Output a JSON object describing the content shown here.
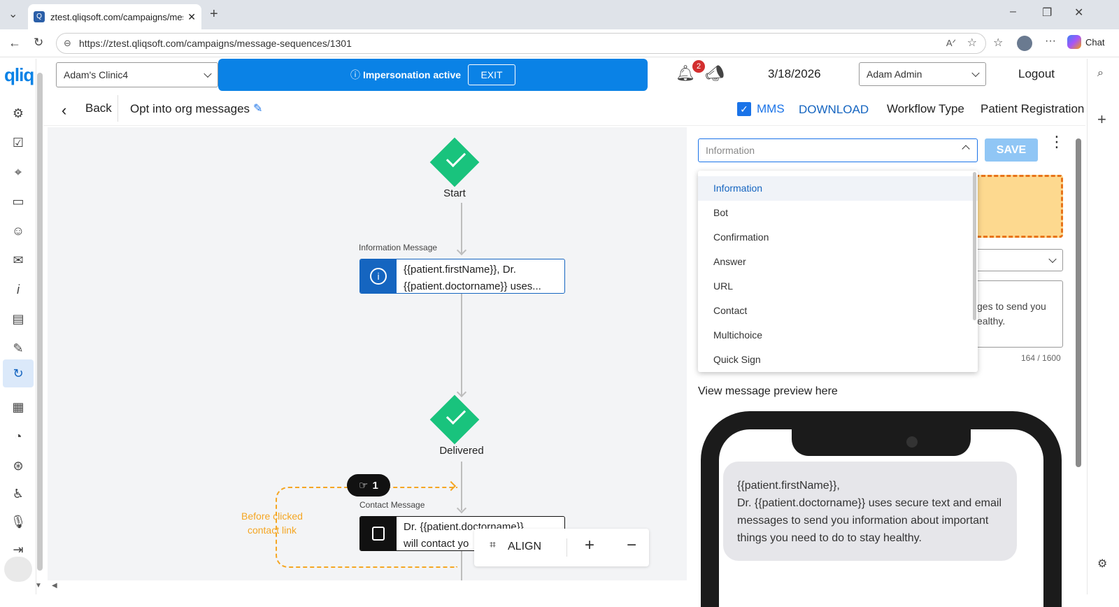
{
  "browser": {
    "tab_title": "ztest.qliqsoft.com/campaigns/mes",
    "url": "https://ztest.qliqsoft.com/campaigns/message-sequences/1301",
    "chat_label": "Chat"
  },
  "app": {
    "logo": "qliq",
    "clinic_select": "Adam's Clinic4",
    "impersonation_text": "Impersonation active",
    "exit_label": "EXIT",
    "notification_count": "2",
    "date": "3/18/2026",
    "user_select": "Adam Admin",
    "logout_label": "Logout"
  },
  "subheader": {
    "back_label": "Back",
    "sequence_title": "Opt into org messages",
    "mms_label": "MMS",
    "mms_checked": true,
    "download_label": "DOWNLOAD",
    "workflow_type_label": "Workflow Type",
    "workflow_type_value": "Patient Registration"
  },
  "canvas": {
    "start_label": "Start",
    "info_node_caption": "Information Message",
    "info_node_line1": "{{patient.firstName}}, Dr.",
    "info_node_line2": "{{patient.doctorname}} uses...",
    "delivered_label": "Delivered",
    "badge_count": "1",
    "branch_label_line1": "Before clicked",
    "branch_label_line2": "contact link",
    "contact_node_caption": "Contact Message",
    "contact_node_line1": "Dr. {{patient.doctorname}}",
    "contact_node_line2": "will contact yo",
    "align_label": "ALIGN"
  },
  "rightpane": {
    "type_select_value": "Information",
    "save_label": "SAVE",
    "dropdown_options": [
      "Information",
      "Bot",
      "Confirmation",
      "Answer",
      "URL",
      "Contact",
      "Multichoice",
      "Quick Sign"
    ],
    "textarea_visible_line1": "ges to send you",
    "textarea_visible_line2": "ealthy.",
    "char_count": "164 / 1600",
    "preview_heading": "View message preview here",
    "preview_line1": "{{patient.firstName}},",
    "preview_line2": "Dr. {{patient.doctorname}} uses secure text and email",
    "preview_line3": "messages to send you information about important",
    "preview_line4": "things you need to do to stay healthy."
  },
  "colors": {
    "accent": "#0a82e6",
    "node_green": "#19c37d",
    "info_node_blue": "#1565c0",
    "branch_orange": "#f5a623",
    "highlight_orange": "#fdd98f"
  }
}
